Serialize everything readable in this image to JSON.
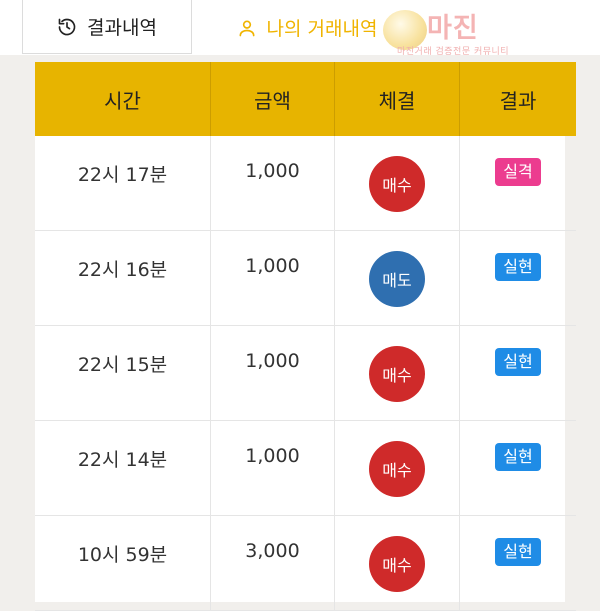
{
  "tabs": [
    {
      "label": "결과내역",
      "icon": "history-icon",
      "active": false
    },
    {
      "label": "나의 거래내역",
      "icon": "user-icon",
      "active": true
    }
  ],
  "logo": {
    "text": "마진",
    "subtext": "마진거래 검증전문 커뮤니티"
  },
  "colors": {
    "accent": "#f0b400",
    "header_bg": "#e7b400",
    "buy": "#cf2a2a",
    "sell": "#2f6fb0",
    "fail": "#ec3c8f",
    "ok": "#1f8ce6"
  },
  "table": {
    "headers": [
      "시간",
      "금액",
      "체결",
      "결과"
    ],
    "rows": [
      {
        "time": "22시 17분",
        "amount": "1,000",
        "exec": "매수",
        "exec_type": "buy",
        "result": "실격",
        "result_type": "fail"
      },
      {
        "time": "22시 16분",
        "amount": "1,000",
        "exec": "매도",
        "exec_type": "sell",
        "result": "실현",
        "result_type": "ok"
      },
      {
        "time": "22시 15분",
        "amount": "1,000",
        "exec": "매수",
        "exec_type": "buy",
        "result": "실현",
        "result_type": "ok"
      },
      {
        "time": "22시 14분",
        "amount": "1,000",
        "exec": "매수",
        "exec_type": "buy",
        "result": "실현",
        "result_type": "ok"
      },
      {
        "time": "10시 59분",
        "amount": "3,000",
        "exec": "매수",
        "exec_type": "buy",
        "result": "실현",
        "result_type": "ok"
      }
    ]
  }
}
